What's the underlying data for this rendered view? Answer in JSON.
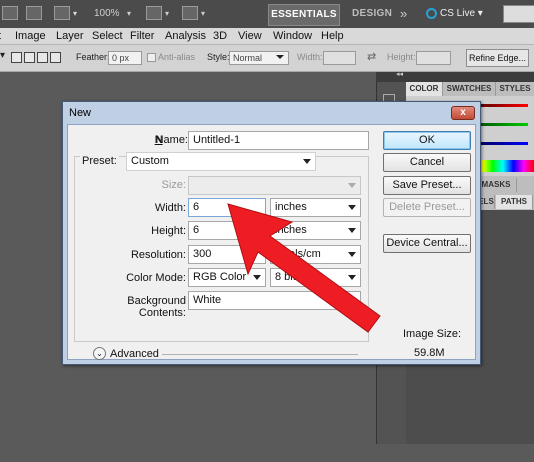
{
  "appbar": {
    "zoom": "100%",
    "essentials": "ESSENTIALS",
    "design": "DESIGN",
    "more": "»",
    "cslive": "CS Live",
    "cslive_caret": "▾"
  },
  "menubar": {
    "items": [
      "Image",
      "Layer",
      "Select",
      "Filter",
      "Analysis",
      "3D",
      "View",
      "Window",
      "Help"
    ]
  },
  "optionsbar": {
    "feather_label": "Feather:",
    "feather_value": "0 px",
    "antialias_label": "Anti-alias",
    "style_label": "Style:",
    "style_value": "Normal",
    "width_label": "Width:",
    "height_label": "Height:",
    "refine_edge": "Refine Edge..."
  },
  "panels": {
    "tabs_top": [
      "COLOR",
      "SWATCHES",
      "STYLES"
    ],
    "masks_tab": "MASKS",
    "paths_tabs": [
      "ELS",
      "PATHS"
    ],
    "collapse_glyph": "◂◂"
  },
  "dialog": {
    "title": "New",
    "close_glyph": "x",
    "name_label": "Name:",
    "name_value": "Untitled-1",
    "preset_label": "Preset:",
    "preset_value": "Custom",
    "size_label": "Size:",
    "width_label": "Width:",
    "width_value": "6",
    "width_unit": "inches",
    "height_label": "Height:",
    "height_value": "6",
    "height_unit": "inches",
    "resolution_label": "Resolution:",
    "resolution_value": "300",
    "resolution_unit": "pixels/cm",
    "colormode_label": "Color Mode:",
    "colormode_value": "RGB Color",
    "bitdepth_value": "8 bit",
    "bg_label": "Background Contents:",
    "bg_value": "White",
    "advanced_label": "Advanced",
    "advanced_glyph": "⌄",
    "buttons": {
      "ok": "OK",
      "cancel": "Cancel",
      "save_preset": "Save Preset...",
      "delete_preset": "Delete Preset...",
      "device_central": "Device Central..."
    },
    "image_size_label": "Image Size:",
    "image_size_value": "59.8M"
  },
  "colors": {
    "arrow": "#ee1d24",
    "dialog_frame": "#bfcfe4",
    "workspace": "#5a5a5a"
  }
}
